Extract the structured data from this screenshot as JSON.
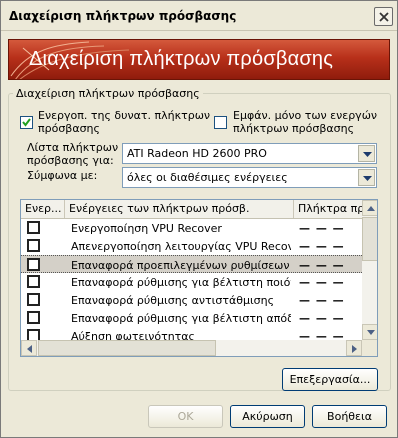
{
  "window": {
    "title": "Διαχείριση πλήκτρων πρόσβασης"
  },
  "banner": {
    "text": "Διαχείριση πλήκτρων πρόσβασης"
  },
  "group": {
    "label": "Διαχείριση πλήκτρων πρόσβασης"
  },
  "options": {
    "enable_all": {
      "label_line1": "Ενεργοπ. της δυνατ. πλήκτρων",
      "label_line2": "πρόσβασης",
      "checked": true
    },
    "show_active_only": {
      "label_line1": "Εμφάν. μόνο των ενεργών",
      "label_line2": "πλήκτρων πρόσβασης",
      "checked": false
    }
  },
  "filters": {
    "list_for_label_line1": "Λίστα πλήκτρων",
    "list_for_label_line2": "πρόσβασης για:",
    "list_for_value": "ATI Radeon HD 2600 PRO",
    "according_label": "Σύμφωνα με:",
    "according_value": "όλες οι διαθέσιμες ενέργειες"
  },
  "table": {
    "columns": [
      "Ενερ...",
      "Ενέργειες των πλήκτρων πρόσβ.",
      "Πλήκτρα πρόσβ"
    ],
    "rows": [
      {
        "action": "Ενεργοποίηση VPU Recover",
        "keys": "— — —",
        "checked": false,
        "selected": false
      },
      {
        "action": "Απενεργοποίηση λειτουργίας VPU Recover",
        "keys": "— — —",
        "checked": false,
        "selected": false
      },
      {
        "action": "Επαναφορά προεπιλεγμένων ρυθμίσεων ...",
        "keys": "— — —",
        "checked": false,
        "selected": true
      },
      {
        "action": "Επαναφορά ρύθμισης για βέλτιστη ποιότητα",
        "keys": "— — —",
        "checked": false,
        "selected": false
      },
      {
        "action": "Επαναφορά ρύθμισης αντιστάθμισης",
        "keys": "— — —",
        "checked": false,
        "selected": false
      },
      {
        "action": "Επαναφορά ρύθμισης για βέλτιστη απόδοση",
        "keys": "— — —",
        "checked": false,
        "selected": false
      },
      {
        "action": "Αύξηση φωτεινότητας",
        "keys": "— — —",
        "checked": false,
        "selected": false
      }
    ]
  },
  "buttons": {
    "edit": "Επεξεργασία...",
    "ok": "OK",
    "cancel": "Ακύρωση",
    "help": "Βοήθεια"
  },
  "colors": {
    "banner_top": "#d4593c",
    "banner_bottom": "#8f1c0c",
    "accent": "#003c74"
  }
}
